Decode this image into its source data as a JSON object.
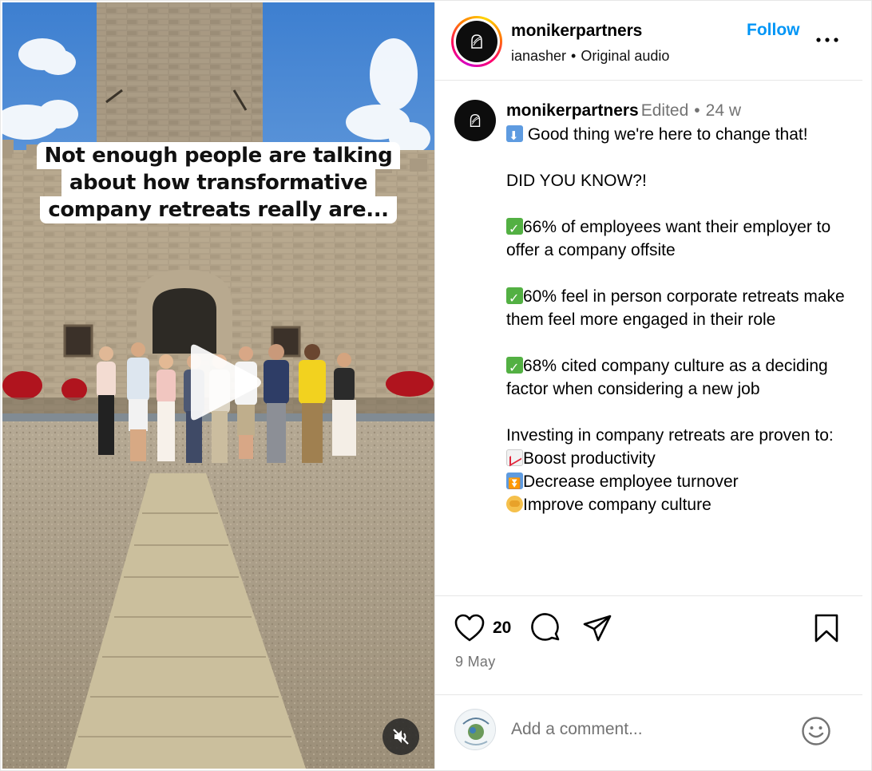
{
  "video": {
    "caption_lines": [
      "Not enough people are talking",
      "about how transformative",
      "company retreats really are..."
    ],
    "play_icon": "play-icon",
    "mute_icon": "muted-speaker-icon"
  },
  "header": {
    "username": "monikerpartners",
    "audio_author": "ianasher",
    "audio_separator": "•",
    "audio_label": "Original audio",
    "follow_label": "Follow",
    "more_icon": "more-horizontal-icon"
  },
  "post": {
    "username": "monikerpartners",
    "edited_label": "Edited",
    "separator": "•",
    "age": "24 w",
    "line_1": " Good thing we're here to change that!",
    "did_you_know": "DID YOU KNOW?!",
    "stat_1": "66% of employees want their employer to offer a company offsite",
    "stat_2": "60% feel in person corporate retreats make them feel more engaged in their role",
    "stat_3": "68% cited company culture as a deciding factor when considering a new job",
    "investing_line": "Investing in company retreats are proven to:",
    "benefit_1": "Boost productivity",
    "benefit_2": "Decrease employee turnover",
    "benefit_3": "Improve company culture"
  },
  "actions": {
    "like_count": "20",
    "date": "9 May",
    "icons": [
      "heart-icon",
      "comment-icon",
      "share-icon",
      "bookmark-icon"
    ]
  },
  "comment": {
    "placeholder": "Add a comment...",
    "emoji_icon": "smiley-icon"
  },
  "colors": {
    "accent": "#0095f6",
    "muted_text": "#737373",
    "border": "#e6e6e6"
  }
}
